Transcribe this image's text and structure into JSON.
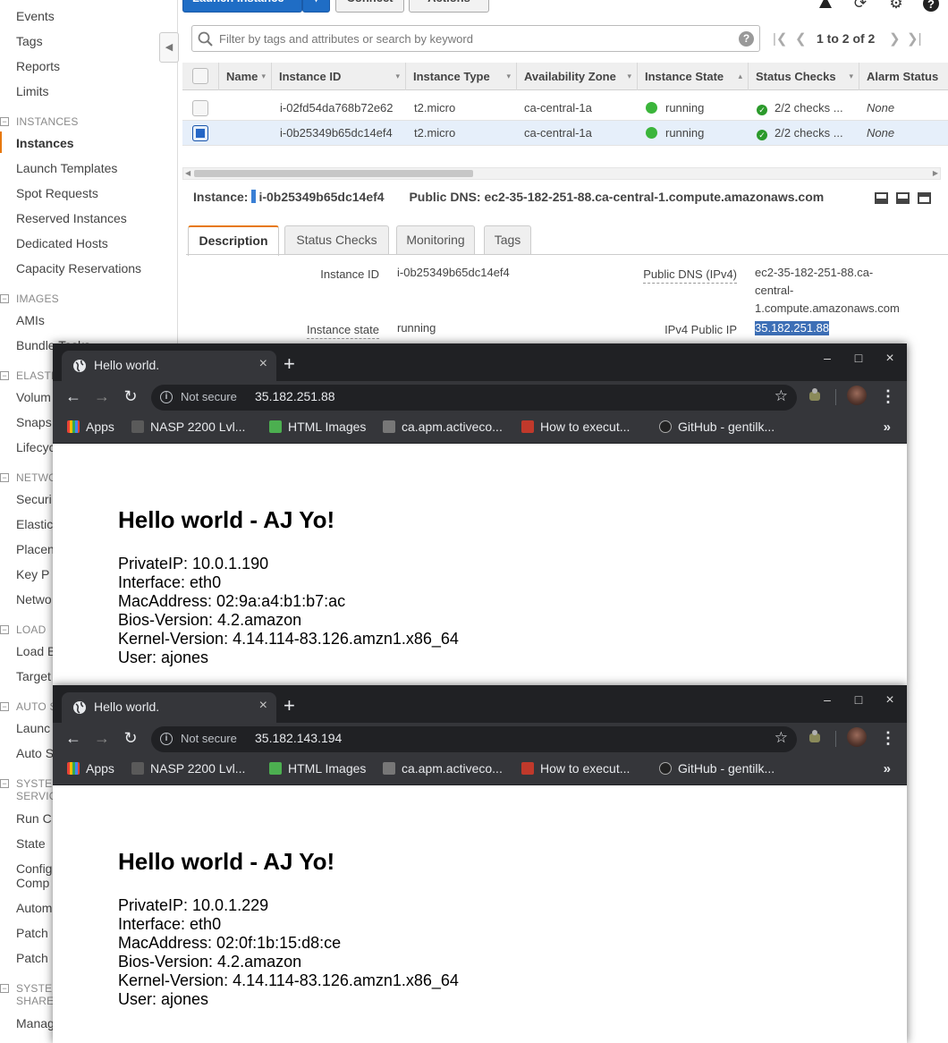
{
  "sidebar": {
    "top_items": [
      "Events",
      "Tags",
      "Reports",
      "Limits"
    ],
    "sections": [
      {
        "title": "INSTANCES",
        "items": [
          "Instances",
          "Launch Templates",
          "Spot Requests",
          "Reserved Instances",
          "Dedicated Hosts",
          "Capacity Reservations"
        ]
      },
      {
        "title": "IMAGES",
        "items": [
          "AMIs",
          "Bundle Tasks"
        ]
      },
      {
        "title": "ELASTIC",
        "items": [
          "Volum",
          "Snaps",
          "Lifecyc"
        ]
      },
      {
        "title": "NETWO",
        "items": [
          "Securi",
          "Elastic",
          "Placen",
          "Key P",
          "Netwo"
        ]
      },
      {
        "title": "LOAD",
        "items": [
          "Load B",
          "Target"
        ]
      },
      {
        "title": "AUTO S",
        "items": [
          "Launc",
          "Auto S"
        ]
      },
      {
        "title": "SYSTE",
        "title2": "SERVIC",
        "items": [
          "Run C",
          "State",
          "Config",
          "Automa",
          "Patch",
          "Patch"
        ],
        "item_extra": "Comp"
      },
      {
        "title": "SYSTE",
        "title2": "SHARE",
        "items": [
          "Manag"
        ]
      }
    ],
    "active_item": "Instances",
    "collapse_icon": "chevron-left-icon"
  },
  "toolbar": {
    "launch_label": "Launch Instance",
    "connect_label": "Connect",
    "actions_label": "Actions"
  },
  "search": {
    "placeholder": "Filter by tags and attributes or search by keyword",
    "help_label": "?"
  },
  "pager": {
    "text": "1 to 2 of 2"
  },
  "table": {
    "columns": [
      "Name",
      "Instance ID",
      "Instance Type",
      "Availability Zone",
      "Instance State",
      "Status Checks",
      "Alarm Status"
    ],
    "rows": [
      {
        "name": "",
        "instance_id": "i-02fd54da768b72e62",
        "type": "t2.micro",
        "az": "ca-central-1a",
        "state": "running",
        "checks": "2/2 checks ...",
        "alarm": "None",
        "selected": false
      },
      {
        "name": "",
        "instance_id": "i-0b25349b65dc14ef4",
        "type": "t2.micro",
        "az": "ca-central-1a",
        "state": "running",
        "checks": "2/2 checks ...",
        "alarm": "None",
        "selected": true
      }
    ]
  },
  "detail": {
    "instance_label": "Instance:",
    "instance_id": "i-0b25349b65dc14ef4",
    "dns_label": "Public DNS:",
    "dns_value": "ec2-35-182-251-88.ca-central-1.compute.amazonaws.com",
    "tabs": [
      "Description",
      "Status Checks",
      "Monitoring",
      "Tags"
    ],
    "active_tab": "Description",
    "fields": {
      "instance_id_label": "Instance ID",
      "instance_id_value": "i-0b25349b65dc14ef4",
      "instance_state_label": "Instance state",
      "instance_state_value": "running",
      "public_dns_label": "Public DNS (IPv4)",
      "public_dns_value_1": "ec2-35-182-251-88.ca-",
      "public_dns_value_2": "central-",
      "public_dns_value_3": "1.compute.amazonaws.com",
      "ipv4_label": "IPv4 Public IP",
      "ipv4_value": "35.182.251.88"
    }
  },
  "browsers": [
    {
      "tab_title": "Hello world.",
      "not_secure": "Not secure",
      "url": "35.182.251.88",
      "heading": "Hello world - AJ Yo!",
      "lines": [
        "PrivateIP: 10.0.1.190",
        "Interface: eth0",
        "MacAddress: 02:9a:a4:b1:b7:ac",
        "Bios-Version: 4.2.amazon",
        "Kernel-Version: 4.14.114-83.126.amzn1.x86_64",
        "User: ajones"
      ]
    },
    {
      "tab_title": "Hello world.",
      "not_secure": "Not secure",
      "url": "35.182.143.194",
      "heading": "Hello world - AJ Yo!",
      "lines": [
        "PrivateIP: 10.0.1.229",
        "Interface: eth0",
        "MacAddress: 02:0f:1b:15:d8:ce",
        "Bios-Version: 4.2.amazon",
        "Kernel-Version: 4.14.114-83.126.amzn1.x86_64",
        "User: ajones"
      ]
    }
  ],
  "bookmarks": [
    "Apps",
    "NASP 2200 Lvl...",
    "HTML Images",
    "ca.apm.activeco...",
    "How to execut...",
    "GitHub - gentilk..."
  ],
  "colors": {
    "aws_blue": "#1f6dc5",
    "aws_orange": "#e7780e",
    "running_green": "#3bb53b",
    "chrome_dark": "#35363a"
  }
}
